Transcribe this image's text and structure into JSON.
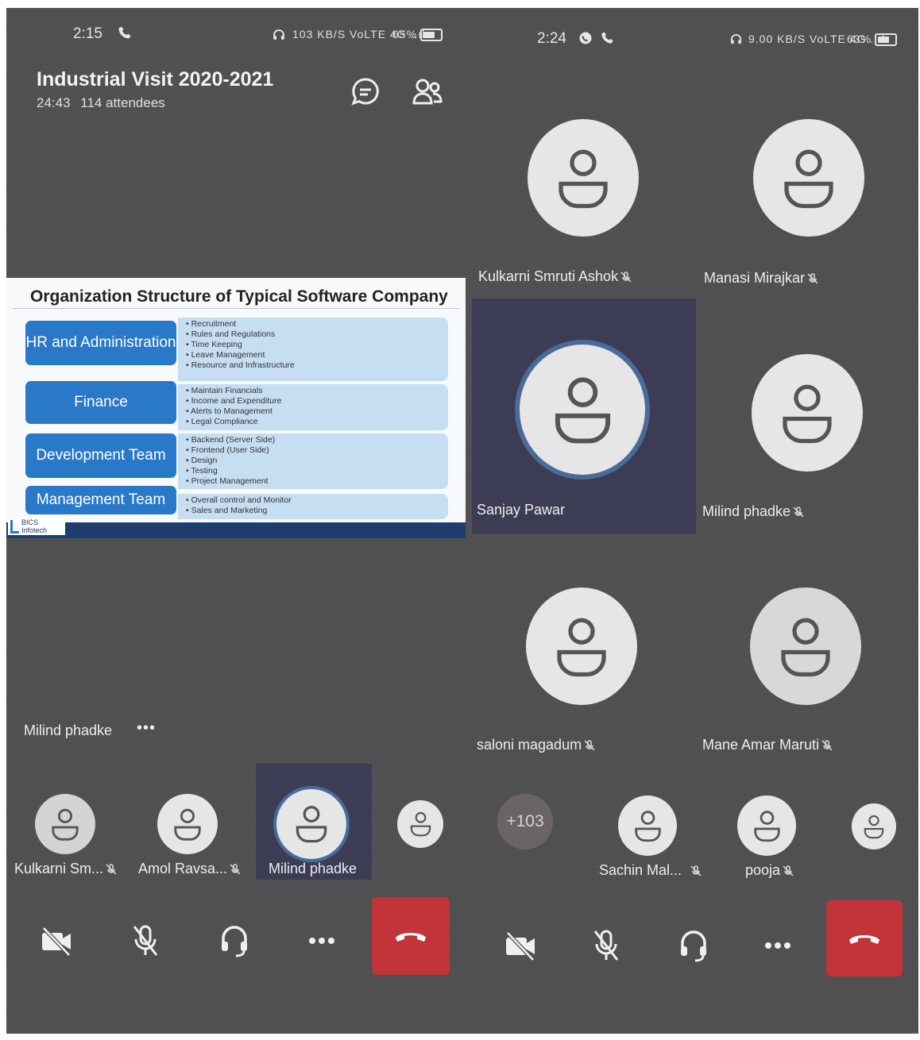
{
  "left_screen": {
    "status": {
      "time": "2:15",
      "right": "103 KB/S VoLTE 4G ..ıl",
      "battery": "65%"
    },
    "meeting": {
      "title": "Industrial Visit 2020-2021",
      "duration": "24:43",
      "attendees": "114 attendees"
    },
    "slide": {
      "title": "Organization Structure of Typical Software Company",
      "logo": "BICS Infotech",
      "rows": [
        {
          "dept": "HR and Administration",
          "items": [
            "Recruitment",
            "Rules and Regulations",
            "Time Keeping",
            "Leave Management",
            "Resource and Infrastructure"
          ]
        },
        {
          "dept": "Finance",
          "items": [
            "Maintain Financials",
            "Income and Expenditure",
            "Alerts to Management",
            "Legal Compliance"
          ]
        },
        {
          "dept": "Development Team",
          "items": [
            "Backend (Server Side)",
            "Frontend (User Side)",
            "Design",
            "Testing",
            "Project Management"
          ]
        },
        {
          "dept": "Management Team",
          "items": [
            "Overall control and Monitor",
            "Sales and Marketing"
          ]
        }
      ]
    },
    "presenter": {
      "name": "Milind phadke",
      "more": "•••"
    },
    "strip": [
      "Kulkarni Sm...",
      "Amol Ravsa...",
      "Milind phadke"
    ]
  },
  "right_screen": {
    "status": {
      "time": "2:24",
      "right": "9.00 KB/S VoLTE 4G ..ıl",
      "battery": "63%"
    },
    "participants": [
      "Kulkarni Smruti Ashok",
      "Manasi Mirajkar",
      "Sanjay Pawar",
      "Milind phadke",
      "saloni magadum",
      "Mane Amar Maruti"
    ],
    "overflow": "+103",
    "strip": [
      "Sachin Mal...",
      "pooja"
    ]
  }
}
